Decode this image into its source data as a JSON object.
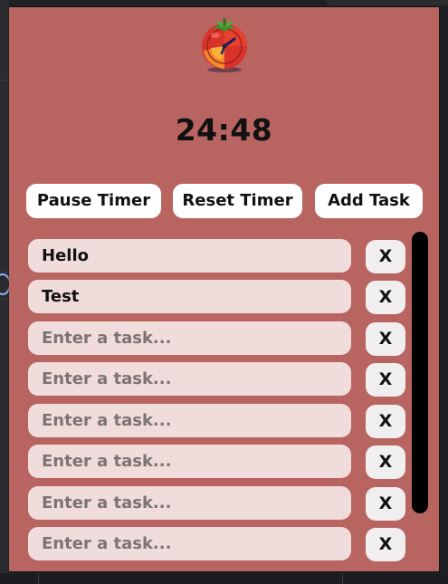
{
  "timer": {
    "display": "24:48"
  },
  "buttons": {
    "pause_label": "Pause Timer",
    "reset_label": "Reset Timer",
    "add_label": "Add Task"
  },
  "tasks": [
    {
      "value": "Hello",
      "placeholder": "Enter a task...",
      "delete_label": "X"
    },
    {
      "value": "Test",
      "placeholder": "Enter a task...",
      "delete_label": "X"
    },
    {
      "value": "",
      "placeholder": "Enter a task...",
      "delete_label": "X"
    },
    {
      "value": "",
      "placeholder": "Enter a task...",
      "delete_label": "X"
    },
    {
      "value": "",
      "placeholder": "Enter a task...",
      "delete_label": "X"
    },
    {
      "value": "",
      "placeholder": "Enter a task...",
      "delete_label": "X"
    },
    {
      "value": "",
      "placeholder": "Enter a task...",
      "delete_label": "X"
    },
    {
      "value": "",
      "placeholder": "Enter a task...",
      "delete_label": "X"
    }
  ],
  "icons": {
    "logo": "tomato-clock-icon"
  },
  "colors": {
    "background": "#b86461",
    "task_field": "#f1dcdc",
    "button": "#ffffff",
    "delete_button": "#f0eeee",
    "scrollbar": "#000000",
    "placeholder_text": "#7d7373"
  }
}
